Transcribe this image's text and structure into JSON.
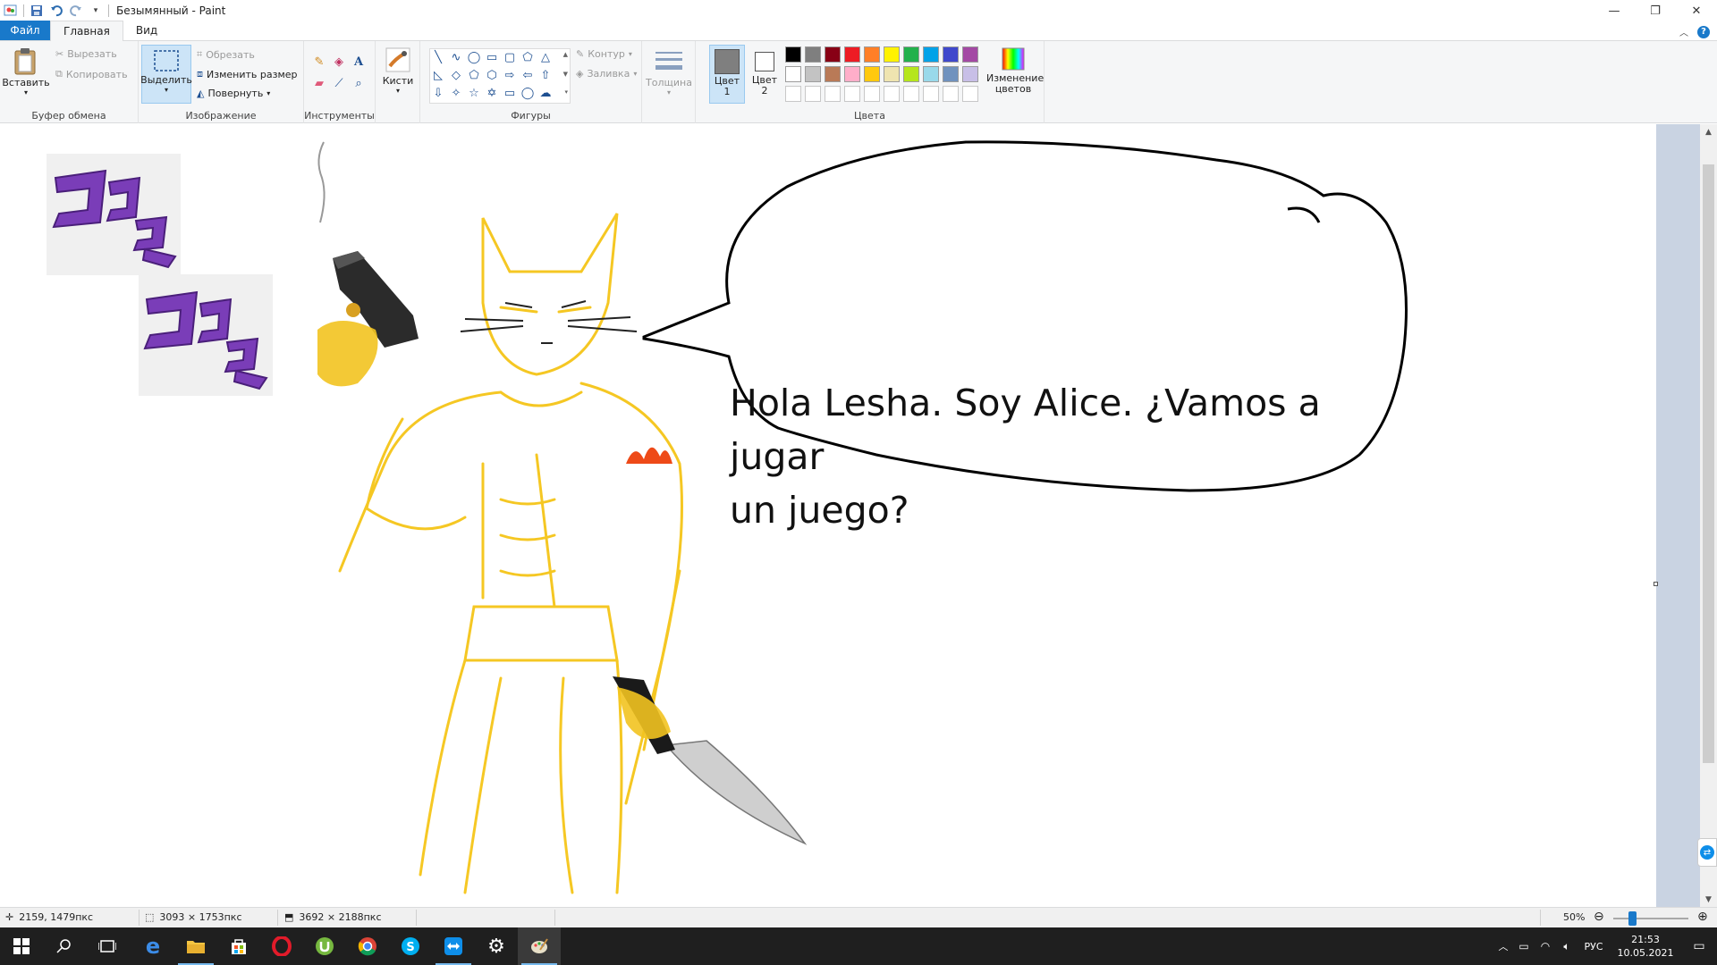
{
  "window": {
    "title": "Безымянный - Paint"
  },
  "tabs": {
    "file": "Файл",
    "home": "Главная",
    "view": "Вид"
  },
  "ribbon": {
    "clipboard": {
      "label": "Буфер обмена",
      "paste": "Вставить",
      "cut": "Вырезать",
      "copy": "Копировать"
    },
    "image": {
      "label": "Изображение",
      "select": "Выделить",
      "crop": "Обрезать",
      "resize": "Изменить размер",
      "rotate": "Повернуть"
    },
    "tools": {
      "label": "Инструменты"
    },
    "brushes": {
      "label": "Кисти"
    },
    "shapes": {
      "label": "Фигуры",
      "outline": "Контур",
      "fill": "Заливка"
    },
    "size": {
      "label": "Толщина"
    },
    "colors": {
      "label": "Цвета",
      "color1": "Цвет 1",
      "color2": "Цвет 2",
      "edit_colors": "Изменение цветов",
      "color1_value": "#7f7f7f",
      "color2_value": "#ffffff",
      "palette_row1": [
        "#000000",
        "#7f7f7f",
        "#880015",
        "#ed1c24",
        "#ff7f27",
        "#fff200",
        "#22b14c",
        "#00a2e8",
        "#3f48cc",
        "#a349a4"
      ],
      "palette_row2": [
        "#ffffff",
        "#c3c3c3",
        "#b97a57",
        "#ffaec9",
        "#ffc90e",
        "#efe4b0",
        "#b5e61d",
        "#99d9ea",
        "#7092be",
        "#c8bfe7"
      ]
    }
  },
  "canvas": {
    "speech_line1": "Hola Lesha. Soy Alice. ¿Vamos a jugar",
    "speech_line2": "un juego?"
  },
  "status": {
    "cursor": "2159, 1479пкс",
    "selection": "3093 × 1753пкс",
    "image_size": "3692 × 2188пкс",
    "zoom": "50%"
  },
  "tray": {
    "language": "РУС",
    "time": "21:53",
    "date": "10.05.2021"
  },
  "colors": {
    "accent": "#1979ca",
    "ribbon_bg": "#f5f6f7",
    "workspace_bg": "#c9d3e2",
    "taskbar_bg": "#1f1f1f"
  }
}
